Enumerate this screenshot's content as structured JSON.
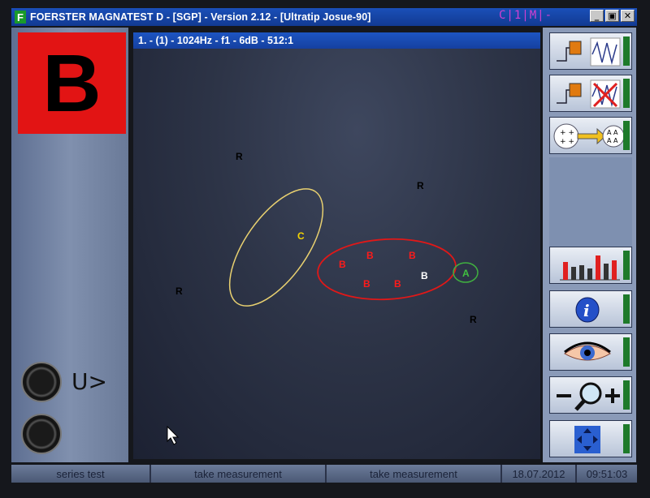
{
  "titlebar": {
    "logo": "F",
    "title": "FOERSTER MAGNATEST D - [SGP] - Version 2.12 - [Ultratip Josue-90]",
    "indicator": "C|1|M|-",
    "minimize_label": "_",
    "restore_label": "▣",
    "close_label": "✕"
  },
  "left_panel": {
    "result_letter": "B",
    "knob_label": "U>"
  },
  "plot": {
    "header": "1. - (1) - 1024Hz - f1 - 6dB - 512:1",
    "colors": {
      "R": "#000000",
      "C": "#f5d400",
      "B_red": "#ff1a1a",
      "B_white": "#ffffff",
      "A": "#40c040"
    },
    "marks": [
      {
        "label": "R",
        "color": "R"
      },
      {
        "label": "R",
        "color": "R"
      },
      {
        "label": "C",
        "color": "C"
      },
      {
        "label": "B",
        "color": "B_red"
      },
      {
        "label": "B",
        "color": "B_red"
      },
      {
        "label": "B",
        "color": "B_red"
      },
      {
        "label": "A",
        "color": "A"
      },
      {
        "label": "B",
        "color": "B_red"
      },
      {
        "label": "B",
        "color": "B_red"
      },
      {
        "label": "B",
        "color": "B_white"
      },
      {
        "label": "R",
        "color": "R"
      },
      {
        "label": "R",
        "color": "R"
      }
    ]
  },
  "right_panel": {
    "buttons": [
      {
        "icon": "signal-acquire-icon"
      },
      {
        "icon": "signal-reject-icon"
      },
      {
        "icon": "transfer-icon"
      },
      {
        "icon": "bar-chart-icon"
      },
      {
        "icon": "info-icon"
      },
      {
        "icon": "eye-icon"
      },
      {
        "icon": "zoom-icon"
      },
      {
        "icon": "move-icon"
      }
    ]
  },
  "statusbar": {
    "cells": [
      "series test",
      "take measurement",
      "take measurement",
      "18.07.2012",
      "09:51:03"
    ]
  }
}
